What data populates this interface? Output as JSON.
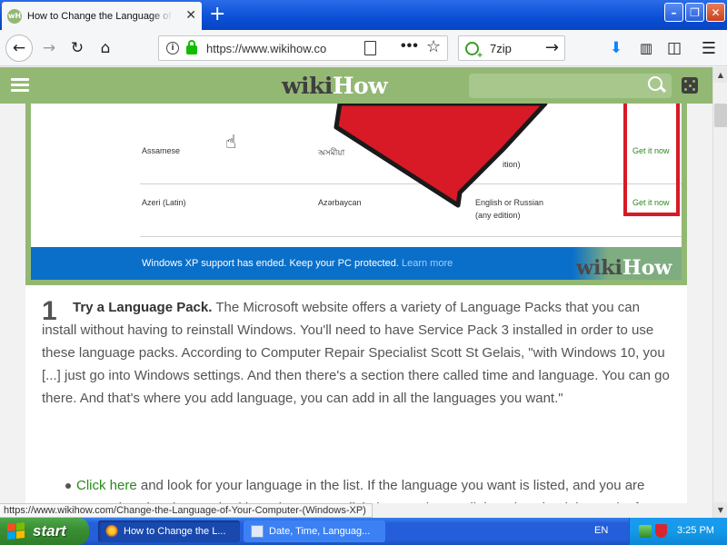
{
  "browser": {
    "tab_title": "How to Change the Language of Y",
    "favicon_text": "wH",
    "url": "https://www.wikihow.co",
    "search_query": "7zip"
  },
  "wikihow": {
    "logo_wiki": "wiki",
    "logo_how": "How"
  },
  "step_image": {
    "rows": [
      {
        "lang": "Assamese",
        "native": "অসমীয়া",
        "req": "",
        "req2": "",
        "action": "Get it now"
      },
      {
        "lang": "Azeri (Latin)",
        "native": "Azərbaycan",
        "req": "English or Russian",
        "req2": "(any edition)",
        "action": "Get it now"
      }
    ],
    "partial_req": "ition)",
    "banner_text": "Windows XP support has ended. Keep your PC protected.",
    "banner_link": "Learn more",
    "watermark_wiki": "wiki",
    "watermark_how": "How"
  },
  "step": {
    "number": "1",
    "title": "Try a Language Pack.",
    "text": "The Microsoft website offers a variety of Language Packs that you can install without having to reinstall Windows. You'll need to have Service Pack 3 installed in order to use these language packs. According to Computer Repair Specialist Scott St Gelais, \"with Windows 10, you [...] just go into Windows settings. And then there's a section there called time and language. You can go there. And that's where you add language, you can add in all the languages you want.\""
  },
  "bullet": {
    "link_text": "Click here",
    "text": " and look for your language in the list. If the language you want is listed, and you are currently using the required base language, click the \"Get it now\" link to download the pack. If your desired language is not listed, or you aren't using the right base language, see"
  },
  "status_url": "https://www.wikihow.com/Change-the-Language-of-Your-Computer-(Windows-XP)",
  "taskbar": {
    "start_label": "start",
    "tasks": [
      {
        "label": "How to Change the L..."
      },
      {
        "label": "Date, Time, Languag..."
      }
    ],
    "language": "EN",
    "clock": "3:25 PM"
  },
  "colors": {
    "wikihow_green": "#93b874",
    "link_green": "#2a8a1a",
    "xp_blue": "#245edb",
    "start_green": "#3a8f35",
    "annotation_red": "#d71a26"
  }
}
